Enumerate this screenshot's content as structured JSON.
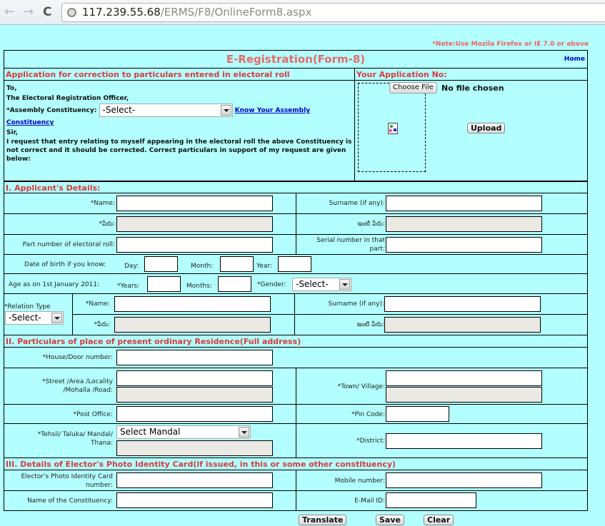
{
  "browser": {
    "url_host": "117.239.55.68",
    "url_path": "/ERMS/F8/OnlineForm8.aspx",
    "back_icon": "←",
    "forward_icon": "→",
    "reload_icon": "C"
  },
  "note": "*Note:Use Mozila Firefox or IE 7.0 or above",
  "header": {
    "title": "E-Registration(Form-8)",
    "home_link": "Home"
  },
  "application": {
    "heading": "Application for correction to particulars entered in electoral roll",
    "to": "To,",
    "officer": "The Electoral Registration Officer,",
    "constituency_label": "*Assembly Constituency:",
    "constituency_value": "-Select-",
    "know_link_1": "Know Your Assembly",
    "know_link_2": "Constituency",
    "sir": "Sir,",
    "request_text": "I request that entry relating to myself appearing in the electoral roll the above Constituency is not correct and it should be corrected. Correct particulars in support of my request are given below:"
  },
  "app_no": {
    "heading": "Your Application No:",
    "choose_file": "Choose File",
    "no_file": "No file chosen",
    "upload": "Upload"
  },
  "section1": {
    "heading": "I. Applicant's Details:",
    "name_label": "*Name:",
    "surname_label": "Surname (if any):",
    "name_te_label": "*పేరు:",
    "surname_te_label": "ఇంటి పేరు:",
    "part_label": "Part number of electoral roll:",
    "serial_label": "Serial number in that part:",
    "dob_label": "Date of birth if you know:",
    "day_label": "Day:",
    "month_label": "Month:",
    "year_label": "Year:",
    "age_label": "Age as on 1st January 2011:",
    "years_label": "*Years:",
    "months_label": "Months:",
    "gender_label": "*Gender:",
    "gender_value": "-Select-",
    "relation_label": "*Relation Type",
    "relation_value": "-Select-",
    "rel_name_label": "*Name:",
    "rel_surname_label": "Surname (if any):",
    "rel_name_te_label": "*పేరు:",
    "rel_surname_te_label": "ఇంటి పేరు:"
  },
  "section2": {
    "heading": "II. Particulars of place of present ordinary Residence(Full address)",
    "house_label": "*House/Door number:",
    "street_label_1": "*Street /Area /Locality",
    "street_label_2": "/Mohalla /Road:",
    "town_label": "*Town/ Village:",
    "post_label": "*Post Office:",
    "pin_label": "*Pin Code:",
    "tehsil_label_1": "*Tehsil/ Taluka/ Mandal/",
    "tehsil_label_2": "Thana:",
    "mandal_value": "Select Mandal",
    "district_label": "*District:"
  },
  "section3": {
    "heading": "III. Details of Elector's Photo Identity Card(if issued, in this or some other constituency)",
    "epic_label_1": "Elector's Photo Identity Card",
    "epic_label_2": "number:",
    "mobile_label": "Mobile number:",
    "const_label": "Name of the Constituency:",
    "email_label": "E-Mail ID:"
  },
  "buttons": {
    "translate": "Translate",
    "save": "Save",
    "clear": "Clear"
  }
}
